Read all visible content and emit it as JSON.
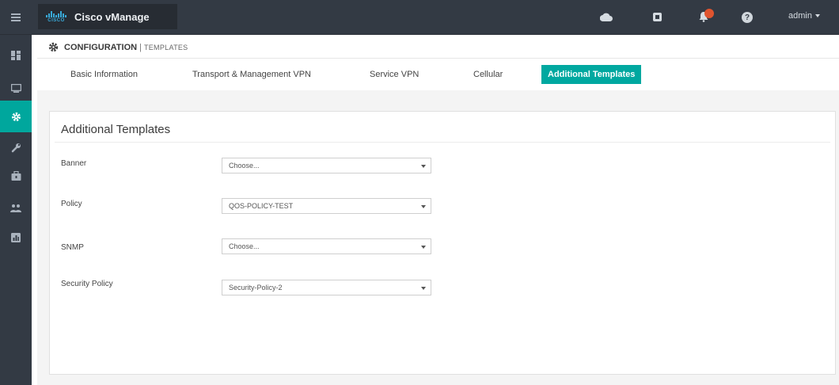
{
  "app": {
    "title": "Cisco vManage",
    "logo_text": "CISCO"
  },
  "topbar": {
    "icons": [
      "cloud-icon",
      "device-icon",
      "bell-icon",
      "help-icon"
    ],
    "notification_count": "",
    "help_glyph": "?",
    "user": "admin"
  },
  "sidebar": {
    "items": [
      {
        "name": "dashboard-icon",
        "active": false
      },
      {
        "name": "monitor-icon",
        "active": false
      },
      {
        "name": "configuration-icon",
        "active": true
      },
      {
        "name": "tools-icon",
        "active": false
      },
      {
        "name": "maintenance-icon",
        "active": false
      },
      {
        "name": "administration-icon",
        "active": false
      },
      {
        "name": "analytics-icon",
        "active": false
      }
    ]
  },
  "breadcrumb": {
    "section": "CONFIGURATION",
    "separator": "|",
    "page": "TEMPLATES"
  },
  "tabs": [
    {
      "label": "Basic Information",
      "active": false
    },
    {
      "label": "Transport & Management VPN",
      "active": false
    },
    {
      "label": "Service VPN",
      "active": false
    },
    {
      "label": "Cellular",
      "active": false
    },
    {
      "label": "Additional Templates",
      "active": true
    }
  ],
  "card": {
    "title": "Additional Templates",
    "fields": [
      {
        "label": "Banner",
        "value": "Choose..."
      },
      {
        "label": "Policy",
        "value": "QOS-POLICY-TEST"
      },
      {
        "label": "SNMP",
        "value": "Choose..."
      },
      {
        "label": "Security Policy",
        "value": "Security-Policy-2"
      }
    ]
  },
  "colors": {
    "topbar": "#333a44",
    "accent": "#00a8a0",
    "badge": "#e0542f"
  }
}
